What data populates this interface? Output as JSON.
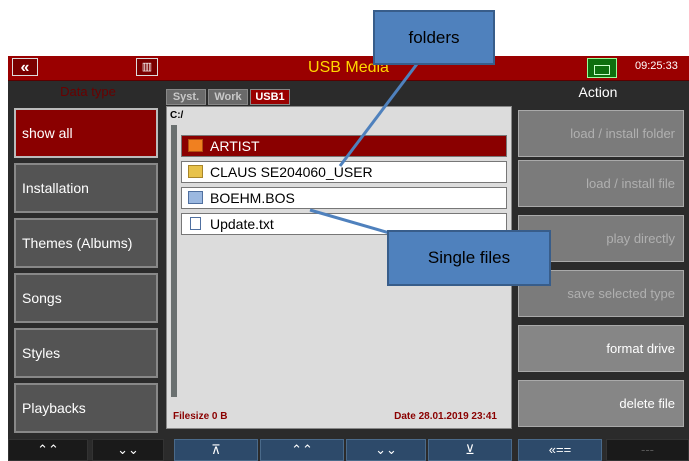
{
  "topbar": {
    "back_glyph": "«",
    "trash_glyph": "🗑",
    "title": "USB Media",
    "clock": "09:25:33"
  },
  "left_header": "Data type",
  "right_header": "Action",
  "data_types": [
    {
      "label": "show all",
      "active": true
    },
    {
      "label": "Installation",
      "active": false
    },
    {
      "label": "Themes (Albums)",
      "active": false
    },
    {
      "label": "Songs",
      "active": false
    },
    {
      "label": "Styles",
      "active": false
    },
    {
      "label": "Playbacks",
      "active": false
    }
  ],
  "tabs": [
    {
      "label": "Syst.",
      "active": false
    },
    {
      "label": "Work",
      "active": false
    },
    {
      "label": "USB1",
      "active": true
    }
  ],
  "browser": {
    "path": "C:/",
    "items": [
      {
        "name": "ARTIST",
        "icon": "folder-red-icon",
        "selected": true
      },
      {
        "name": "CLAUS SE204060_USER",
        "icon": "folder-icon",
        "selected": false
      },
      {
        "name": "BOEHM.BOS",
        "icon": "bos-file-icon",
        "selected": false
      },
      {
        "name": "Update.txt",
        "icon": "text-file-icon",
        "selected": false
      }
    ],
    "filesize": "Filesize 0 B",
    "date": "Date 28.01.2019  23:41"
  },
  "actions": [
    {
      "label": "load  /  install folder",
      "enabled": false
    },
    {
      "label": "load  /  install file",
      "enabled": false
    },
    {
      "label": "play  directly",
      "enabled": false
    },
    {
      "label": "save  selected  type",
      "enabled": false
    },
    {
      "label": "format  drive",
      "enabled": true
    },
    {
      "label": "delete  file",
      "enabled": true
    }
  ],
  "bottom_buttons": [
    {
      "label": "⌃⌃",
      "style": "dark"
    },
    {
      "label": "⌄⌄",
      "style": "dark"
    },
    {
      "label": "⊼",
      "style": "blue"
    },
    {
      "label": "⌃⌃",
      "style": "blue"
    },
    {
      "label": "⌄⌄",
      "style": "blue"
    },
    {
      "label": "⊻",
      "style": "blue"
    },
    {
      "label": "«==",
      "style": "blue"
    },
    {
      "label": "---",
      "style": "dark-dim"
    }
  ],
  "callouts": {
    "folders": "folders",
    "single_files": "Single files"
  },
  "colors": {
    "accent_red": "#9a0000",
    "title_yellow": "#ffd800",
    "callout_blue": "#4f81bd"
  }
}
